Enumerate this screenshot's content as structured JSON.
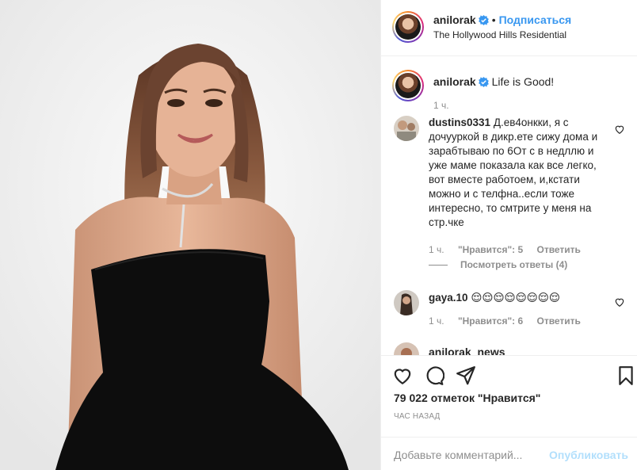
{
  "header": {
    "username": "anilorak",
    "separator": "•",
    "follow_label": "Подписаться",
    "location": "The Hollywood Hills Residential"
  },
  "caption": {
    "username": "anilorak",
    "text": "Life is Good!",
    "time": "1 ч."
  },
  "comments": [
    {
      "username": "dustins0331",
      "text": "Д.ев4онкки, я с дочуурк​ой в дикр.ете сижу дома и зарабтываю по 6От с в недллю и уже маме показала как все легко, вот вместе работоем, и,кстати можно и с телфна..если тоже интересно, то смтрите у меня на стр.чке",
      "time": "1 ч.",
      "likes": "\"Нравится\": 5",
      "reply": "Ответить",
      "view_replies": "Посмотреть ответы (4)"
    },
    {
      "username": "gaya.10",
      "text": "😌😌😌😌😌😌😌😌",
      "time": "1 ч.",
      "likes": "\"Нравится\": 6",
      "reply": "Ответить"
    }
  ],
  "partial_comment": {
    "username": "anilorak_news"
  },
  "actions": {
    "likes_count": "79 022 отметок \"Нравится\"",
    "posted_ago": "ЧАС НАЗАД"
  },
  "add_comment": {
    "placeholder": "Добавьте комментарий...",
    "publish_label": "Опубликовать"
  },
  "icons": {
    "like": "heart-icon",
    "comment": "comment-icon",
    "share": "direct-share-icon",
    "save": "bookmark-icon",
    "verified": "verified-badge-icon"
  },
  "colors": {
    "link": "#3897f0",
    "verified": "#3897f0",
    "muted": "#8e8e8e",
    "publish_disabled": "#b2dffc"
  }
}
